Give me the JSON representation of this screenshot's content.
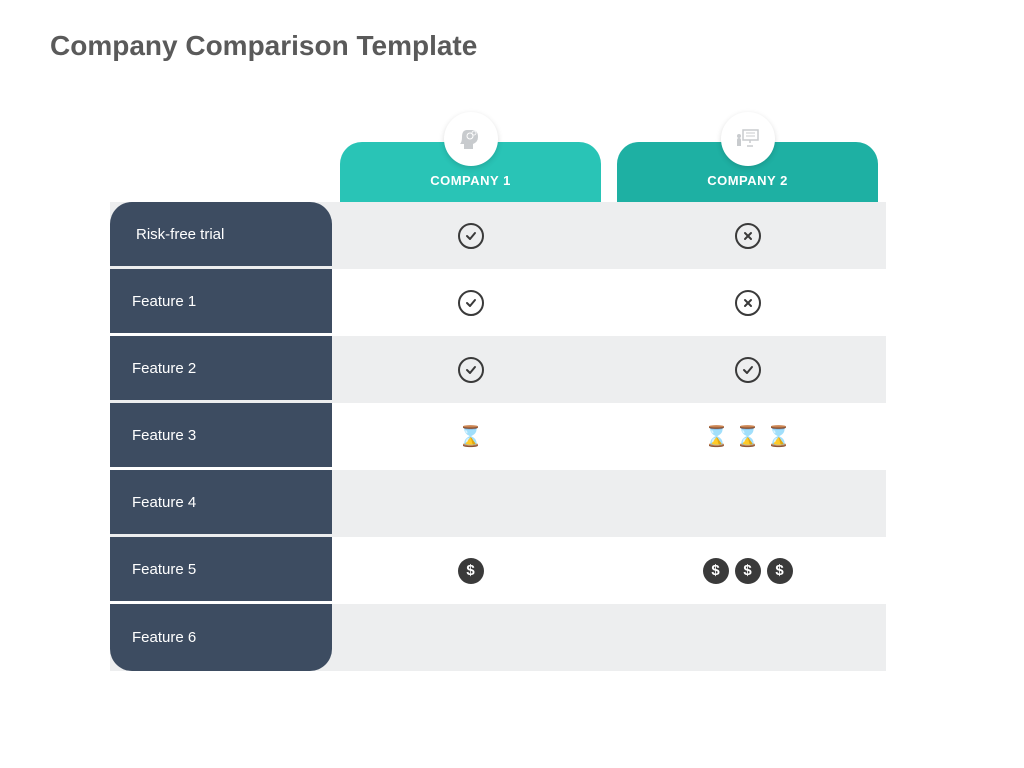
{
  "title": "Company Comparison Template",
  "columns": {
    "company1": {
      "label": "COMPANY 1",
      "icon": "head-gears"
    },
    "company2": {
      "label": "COMPANY 2",
      "icon": "presentation"
    }
  },
  "features": [
    {
      "label": "Risk-free trial",
      "company1": {
        "type": "check",
        "count": 1
      },
      "company2": {
        "type": "cross",
        "count": 1
      }
    },
    {
      "label": "Feature 1",
      "company1": {
        "type": "check",
        "count": 1
      },
      "company2": {
        "type": "cross",
        "count": 1
      }
    },
    {
      "label": "Feature 2",
      "company1": {
        "type": "check",
        "count": 1
      },
      "company2": {
        "type": "check",
        "count": 1
      }
    },
    {
      "label": "Feature 3",
      "company1": {
        "type": "hourglass",
        "count": 1
      },
      "company2": {
        "type": "hourglass",
        "count": 3
      }
    },
    {
      "label": "Feature 4",
      "company1": {
        "type": "empty",
        "count": 0
      },
      "company2": {
        "type": "empty",
        "count": 0
      }
    },
    {
      "label": "Feature 5",
      "company1": {
        "type": "dollar",
        "count": 1
      },
      "company2": {
        "type": "dollar",
        "count": 3
      }
    },
    {
      "label": "Feature 6",
      "company1": {
        "type": "empty",
        "count": 0
      },
      "company2": {
        "type": "empty",
        "count": 0
      }
    }
  ]
}
